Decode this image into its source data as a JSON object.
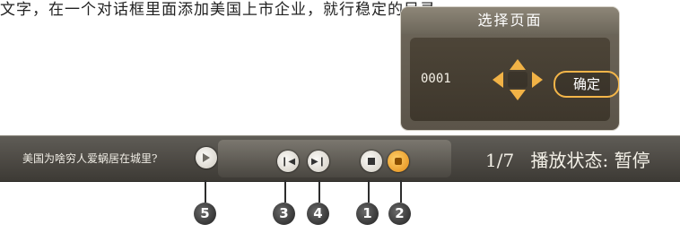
{
  "top_text": "文字，在一个对话框里面添加美国上市企业，就行稳定的目录。",
  "dialog": {
    "title": "选择页面",
    "page_number": "0001",
    "confirm_label": "确定"
  },
  "bar": {
    "text": "美国为啥穷人爱蜗居在城里?",
    "page_indicator": "1/7",
    "status_label": "播放状态:",
    "status_value": "暂停"
  },
  "callouts": [
    {
      "label": "5"
    },
    {
      "label": "3"
    },
    {
      "label": "4"
    },
    {
      "label": "1"
    },
    {
      "label": "2"
    }
  ],
  "colors": {
    "accent_orange": "#f1b246",
    "bar_background": "#4a4741",
    "dialog_background": "#5b5449"
  },
  "icons": {
    "btn5": "circle-arrow-icon",
    "btn3": "skip-back-icon",
    "btn4": "skip-forward-icon",
    "btn1": "stop-icon",
    "btn2": "orange-page-icon"
  }
}
